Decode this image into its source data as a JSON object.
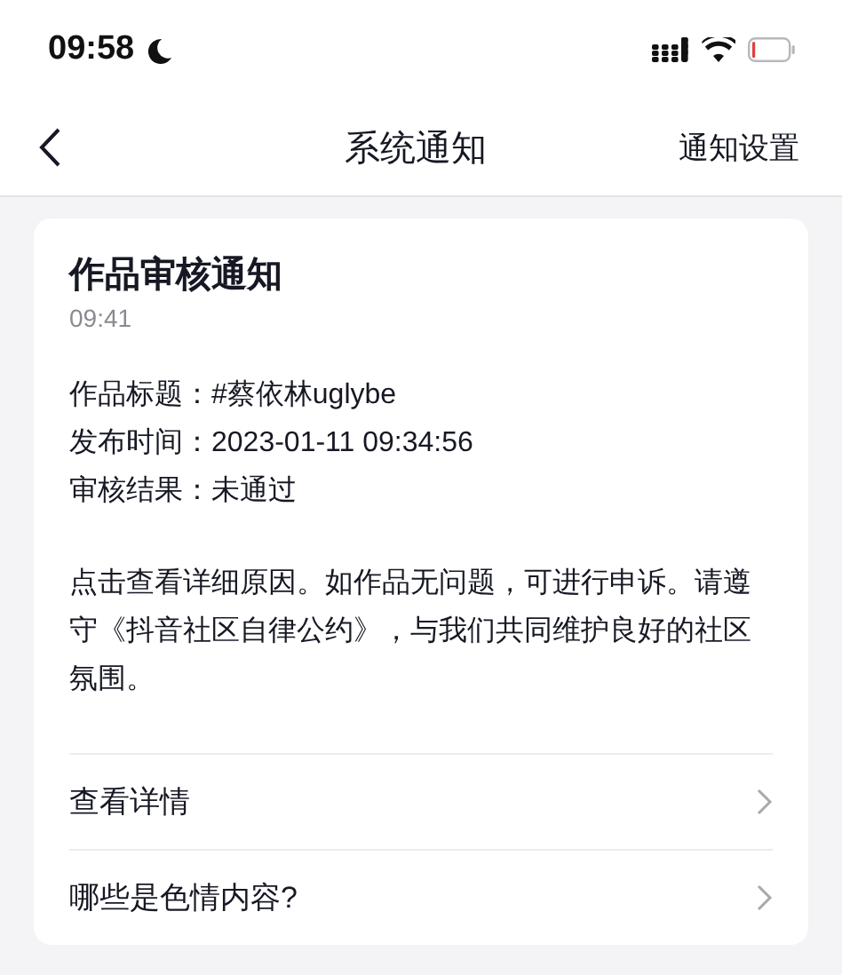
{
  "status_bar": {
    "time": "09:58"
  },
  "nav": {
    "title": "系统通知",
    "action": "通知设置"
  },
  "card": {
    "title": "作品审核通知",
    "time": "09:41",
    "fields": [
      {
        "label": "作品标题：",
        "value": "#蔡依林uglybe"
      },
      {
        "label": "发布时间：",
        "value": "2023-01-11 09:34:56"
      },
      {
        "label": "审核结果：",
        "value": "未通过"
      }
    ],
    "message": "点击查看详细原因。如作品无问题，可进行申诉。请遵守《抖音社区自律公约》，与我们共同维护良好的社区氛围。",
    "links": [
      "查看详情",
      "哪些是色情内容?"
    ]
  }
}
